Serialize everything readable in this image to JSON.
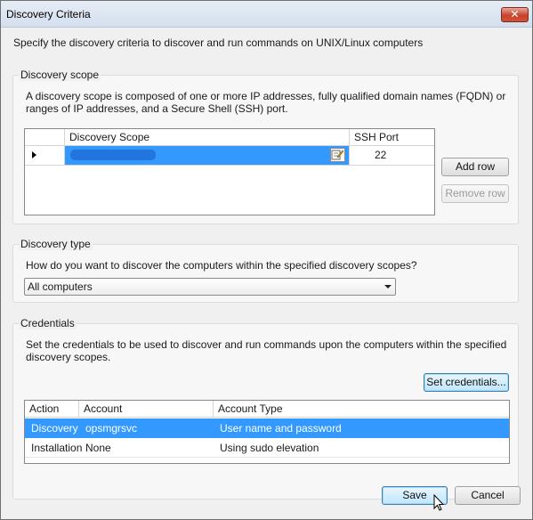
{
  "window": {
    "title": "Discovery Criteria"
  },
  "intro": "Specify the discovery criteria to discover and run commands on UNIX/Linux computers",
  "scope": {
    "legend": "Discovery scope",
    "description_line1": "A discovery scope is composed of one or more IP addresses, fully qualified domain names (FQDN) or",
    "description_line2": "ranges of IP addresses, and a Secure Shell (SSH) port.",
    "columns": [
      "Discovery Scope",
      "SSH Port"
    ],
    "rows": [
      {
        "scope": "",
        "port": "22"
      }
    ],
    "add_row": "Add row",
    "remove_row": "Remove row"
  },
  "type": {
    "legend": "Discovery type",
    "question": "How do you want to discover the computers within the specified discovery scopes?",
    "selected": "All computers"
  },
  "credentials": {
    "legend": "Credentials",
    "description_line1": "Set the credentials to be used to discover and run commands upon the computers within the specified",
    "description_line2": "discovery scopes.",
    "set_button": "Set credentials...",
    "columns": [
      "Action",
      "Account",
      "Account Type"
    ],
    "rows": [
      {
        "action": "Discovery",
        "account": "opsmgrsvc",
        "type": "User name and password"
      },
      {
        "action": "Installation",
        "account": "None",
        "type": "Using sudo elevation"
      }
    ]
  },
  "footer": {
    "save": "Save",
    "cancel": "Cancel"
  },
  "colors": {
    "selection": "#3399ff",
    "close": "#c7432b"
  }
}
